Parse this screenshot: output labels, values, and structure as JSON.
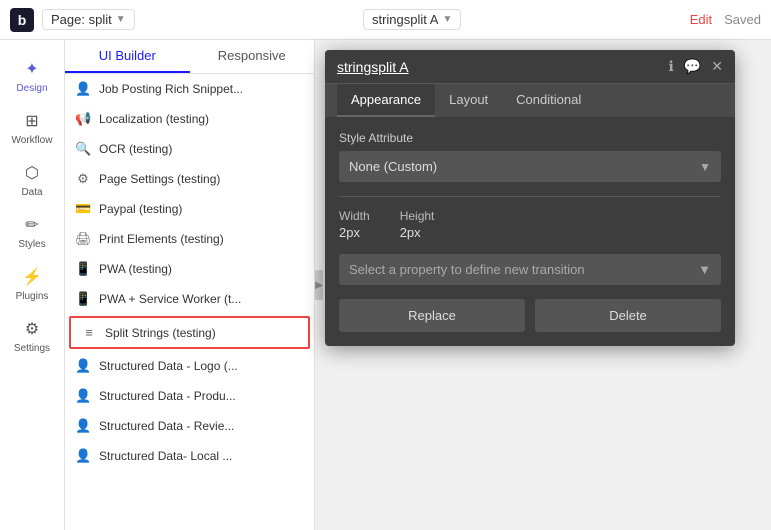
{
  "topbar": {
    "logo": "b",
    "page_label": "Page: split",
    "page_arrow": "▼",
    "workflow_label": "stringsplit A",
    "workflow_arrow": "▼",
    "edit_label": "Edit",
    "saved_label": "Saved"
  },
  "icon_sidebar": {
    "items": [
      {
        "id": "design",
        "label": "Design",
        "icon": "✦",
        "active": true
      },
      {
        "id": "workflow",
        "label": "Workflow",
        "icon": "⊞"
      },
      {
        "id": "data",
        "label": "Data",
        "icon": "⬡"
      },
      {
        "id": "styles",
        "label": "Styles",
        "icon": "✏"
      },
      {
        "id": "plugins",
        "label": "Plugins",
        "icon": "⚡"
      },
      {
        "id": "settings",
        "label": "Settings",
        "icon": "⚙"
      }
    ]
  },
  "tabs": {
    "ui_builder": "UI Builder",
    "responsive": "Responsive"
  },
  "plugin_list": {
    "items": [
      {
        "icon": "👤",
        "label": "Job Posting Rich Snippet..."
      },
      {
        "icon": "📢",
        "label": "Localization (testing)"
      },
      {
        "icon": "🔍",
        "label": "OCR (testing)"
      },
      {
        "icon": "⚙",
        "label": "Page Settings (testing)"
      },
      {
        "icon": "💳",
        "label": "Paypal (testing)"
      },
      {
        "icon": "🖨",
        "label": "Print Elements (testing)"
      },
      {
        "icon": "📱",
        "label": "PWA (testing)"
      },
      {
        "icon": "📱",
        "label": "PWA + Service Worker (t..."
      },
      {
        "icon": "≡",
        "label": "Split Strings (testing)",
        "selected": true
      },
      {
        "icon": "👤",
        "label": "Structured Data - Logo (..."
      },
      {
        "icon": "👤",
        "label": "Structured Data - Produ..."
      },
      {
        "icon": "👤",
        "label": "Structured Data - Revie..."
      },
      {
        "icon": "👤",
        "label": "Structured Data- Local ..."
      }
    ]
  },
  "modal": {
    "title": "stringsplit A",
    "tabs": [
      "Appearance",
      "Layout",
      "Conditional"
    ],
    "active_tab": "Appearance",
    "style_attribute_label": "Style Attribute",
    "style_attribute_value": "None (Custom)",
    "width_label": "Width",
    "width_value": "2px",
    "height_label": "Height",
    "height_value": "2px",
    "transition_placeholder": "Select a property to define new transition",
    "replace_label": "Replace",
    "delete_label": "Delete",
    "header_icons": [
      "ℹ",
      "💬",
      "✕"
    ]
  }
}
